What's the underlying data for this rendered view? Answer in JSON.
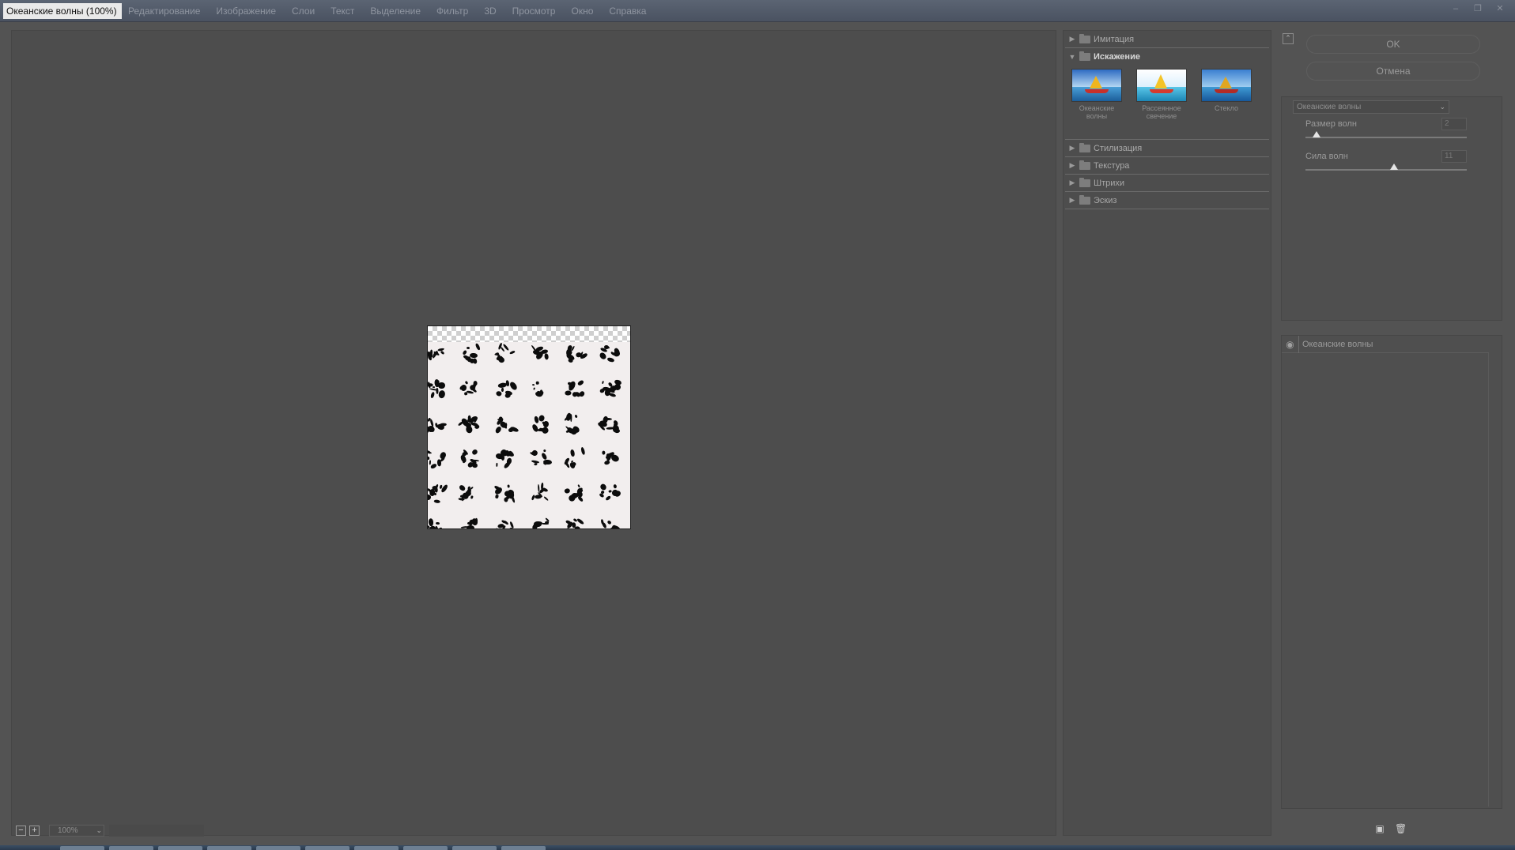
{
  "window": {
    "title": "Океанские волны (100%)",
    "controls": [
      "–",
      "❐",
      "✕"
    ]
  },
  "menu": [
    "Редактирование",
    "Изображение",
    "Слои",
    "Текст",
    "Выделение",
    "Фильтр",
    "3D",
    "Просмотр",
    "Окно",
    "Справка"
  ],
  "zoom": {
    "value": "100%",
    "minus": "−",
    "plus": "+"
  },
  "gallery": {
    "folders_top": [
      {
        "label": "Имитация"
      }
    ],
    "open_folder": {
      "label": "Искажение",
      "thumbnails": [
        {
          "caption": "Океанские волны"
        },
        {
          "caption": "Рассеянное свечение"
        },
        {
          "caption": "Стекло"
        }
      ]
    },
    "folders_bottom": [
      {
        "label": "Стилизация"
      },
      {
        "label": "Текстура"
      },
      {
        "label": "Штрихи"
      },
      {
        "label": "Эскиз"
      }
    ]
  },
  "settings": {
    "ok_label": "OK",
    "cancel_label": "Отмена",
    "selected_filter": "Океанские волны",
    "params": [
      {
        "label": "Размер волн",
        "value": "2",
        "fraction": 0.07
      },
      {
        "label": "Сила волн",
        "value": "11",
        "fraction": 0.55
      }
    ]
  },
  "layers": {
    "items": [
      {
        "label": "Океанские волны"
      }
    ]
  },
  "colors": {
    "background": "#535353",
    "panel": "#4d4d4d",
    "titlebar": "#4a5261"
  }
}
